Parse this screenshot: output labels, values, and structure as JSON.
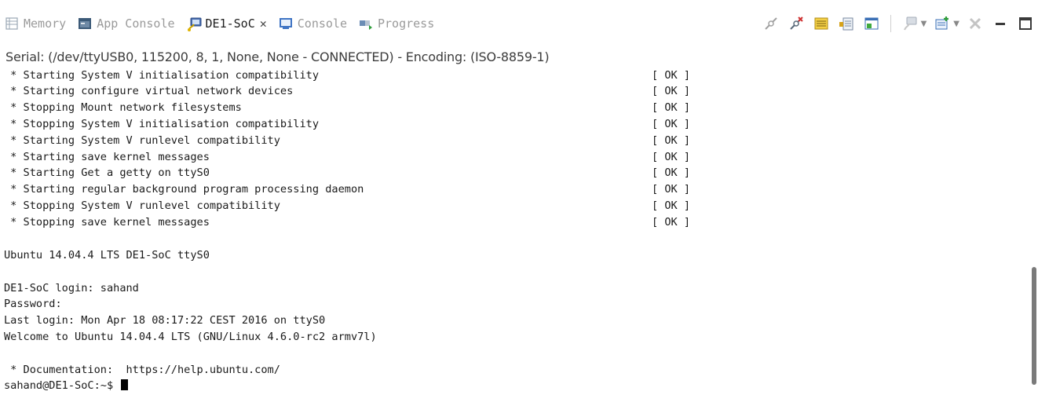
{
  "tabs": [
    {
      "label": "Memory",
      "icon": "memory-icon"
    },
    {
      "label": "App Console",
      "icon": "app-console-icon"
    },
    {
      "label": "DE1-SoC",
      "icon": "terminal-icon",
      "active": true,
      "close": "✕"
    },
    {
      "label": "Console",
      "icon": "console-icon"
    },
    {
      "label": "Progress",
      "icon": "progress-icon"
    }
  ],
  "toolbar": {
    "icons": [
      "connect-icon",
      "disconnect-icon",
      "settings-icon",
      "scroll-lock-icon",
      "clear-console-icon",
      "open-terminal-icon",
      "new-terminal-icon",
      "remove-icon",
      "minimize-icon",
      "maximize-icon"
    ]
  },
  "status": {
    "text": "Serial: (/dev/ttyUSB0, 115200, 8, 1, None, None - CONNECTED) - Encoding: (ISO-8859-1)"
  },
  "terminal": {
    "boot_lines": [
      {
        "msg": " * Starting System V initialisation compatibility",
        "status": "[ OK ]"
      },
      {
        "msg": " * Starting configure virtual network devices",
        "status": "[ OK ]"
      },
      {
        "msg": " * Stopping Mount network filesystems",
        "status": "[ OK ]"
      },
      {
        "msg": " * Stopping System V initialisation compatibility",
        "status": "[ OK ]"
      },
      {
        "msg": " * Starting System V runlevel compatibility",
        "status": "[ OK ]"
      },
      {
        "msg": " * Starting save kernel messages",
        "status": "[ OK ]"
      },
      {
        "msg": " * Starting Get a getty on ttyS0",
        "status": "[ OK ]"
      },
      {
        "msg": " * Starting regular background program processing daemon",
        "status": "[ OK ]"
      },
      {
        "msg": " * Stopping System V runlevel compatibility",
        "status": "[ OK ]"
      },
      {
        "msg": " * Stopping save kernel messages",
        "status": "[ OK ]"
      }
    ],
    "banner": "Ubuntu 14.04.4 LTS DE1-SoC ttyS0",
    "login_prompt": "DE1-SoC login: sahand",
    "password_prompt": "Password:",
    "last_login": "Last login: Mon Apr 18 08:17:22 CEST 2016 on ttyS0",
    "welcome": "Welcome to Ubuntu 14.04.4 LTS (GNU/Linux 4.6.0-rc2 armv7l)",
    "documentation": " * Documentation:  https://help.ubuntu.com/",
    "shell_prompt": "sahand@DE1-SoC:~$ "
  }
}
